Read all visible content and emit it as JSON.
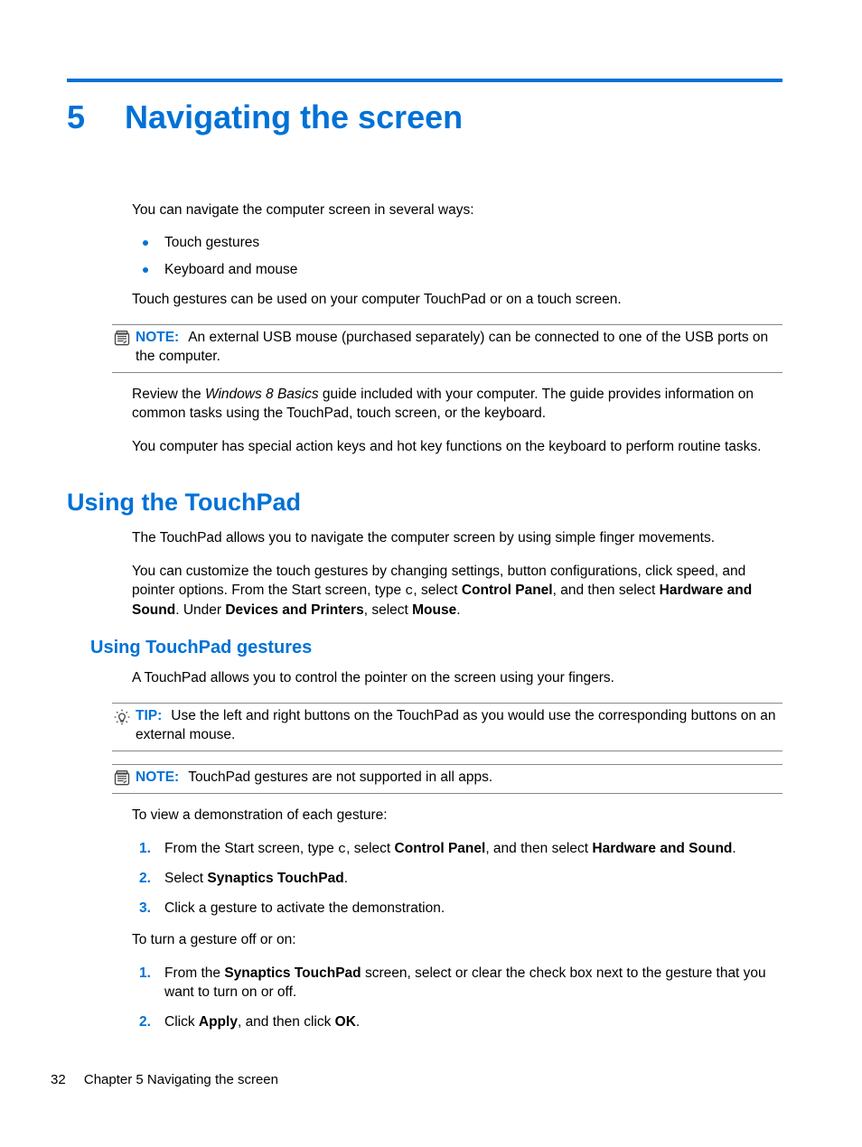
{
  "chapter": {
    "number": "5",
    "title": "Navigating the screen"
  },
  "intro": {
    "lead": "You can navigate the computer screen in several ways:",
    "bullets": [
      "Touch gestures",
      "Keyboard and mouse"
    ],
    "after": "Touch gestures can be used on your computer TouchPad or on a touch screen."
  },
  "note1": {
    "label": "NOTE:",
    "text": "An external USB mouse (purchased separately) can be connected to one of the USB ports on the computer."
  },
  "review": {
    "pre": "Review the ",
    "em": "Windows 8 Basics",
    "post": " guide included with your computer. The guide provides information on common tasks using the TouchPad, touch screen, or the keyboard."
  },
  "hotkeys": "You computer has special action keys and hot key functions on the keyboard to perform routine tasks.",
  "sec1": {
    "title": "Using the TouchPad",
    "p1": "The TouchPad allows you to navigate the computer screen by using simple finger movements.",
    "p2": {
      "a": "You can customize the touch gestures by changing settings, button configurations, click speed, and pointer options. From the Start screen, type ",
      "mono": "c",
      "b": ", select ",
      "s1": "Control Panel",
      "c": ", and then select ",
      "s2": "Hardware and Sound",
      "d": ". Under ",
      "s3": "Devices and Printers",
      "e": ", select ",
      "s4": "Mouse",
      "f": "."
    }
  },
  "sub1": {
    "title": "Using TouchPad gestures",
    "p1": "A TouchPad allows you to control the pointer on the screen using your fingers."
  },
  "tip1": {
    "label": "TIP:",
    "text": "Use the left and right buttons on the TouchPad as you would use the corresponding buttons on an external mouse."
  },
  "note2": {
    "label": "NOTE:",
    "text": "TouchPad gestures are not supported in all apps."
  },
  "demo": {
    "lead": "To view a demonstration of each gesture:",
    "step1": {
      "a": "From the Start screen, type ",
      "mono": "c",
      "b": ", select ",
      "s1": "Control Panel",
      "c": ", and then select ",
      "s2": "Hardware and Sound",
      "d": "."
    },
    "step2": {
      "a": "Select ",
      "s1": "Synaptics TouchPad",
      "b": "."
    },
    "step3": "Click a gesture to activate the demonstration."
  },
  "toggle": {
    "lead": "To turn a gesture off or on:",
    "step1": {
      "a": "From the ",
      "s1": "Synaptics TouchPad",
      "b": " screen, select or clear the check box next to the gesture that you want to turn on or off."
    },
    "step2": {
      "a": "Click ",
      "s1": "Apply",
      "b": ", and then click ",
      "s2": "OK",
      "c": "."
    }
  },
  "footer": {
    "page": "32",
    "chapter": "Chapter 5   Navigating the screen"
  }
}
